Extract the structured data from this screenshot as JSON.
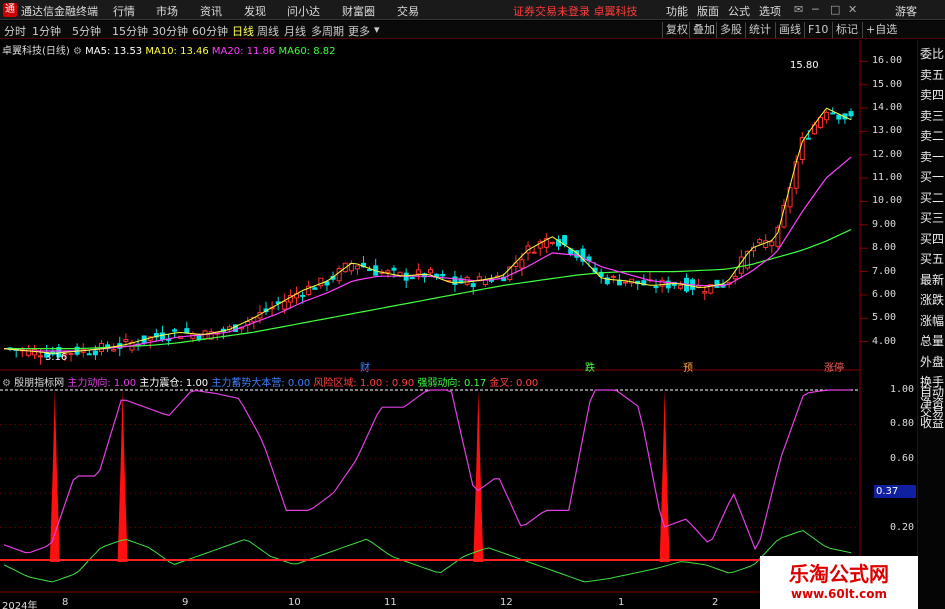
{
  "app": {
    "title": "通达信金融终端",
    "logo": "通"
  },
  "menu": [
    "行情",
    "市场",
    "资讯",
    "发现",
    "问小达",
    "财富圈",
    "交易"
  ],
  "notice": "证券交易未登录   卓翼科技",
  "right_menu": [
    "功能",
    "版面",
    "公式",
    "选项"
  ],
  "window_controls": {
    "user": "游客"
  },
  "periods": [
    "分时",
    "1分钟",
    "5分钟",
    "15分钟",
    "30分钟",
    "60分钟",
    "日线",
    "周线",
    "月线",
    "多周期",
    "更多"
  ],
  "active_period": "日线",
  "toolbar": {
    "restore": "复权",
    "overlay": "叠加",
    "multi": "多股",
    "stats": "统计",
    "draw": "画线",
    "f10": "F10",
    "mark": "标记",
    "watchlist": "+自选"
  },
  "sidebar": [
    "委比",
    "卖五",
    "卖四",
    "卖三",
    "卖二",
    "卖一",
    "买一",
    "买二",
    "买三",
    "买四",
    "买五",
    "最新",
    "涨跌",
    "涨幅",
    "总量",
    "外盘",
    "换手",
    "净资",
    "收益",
    "自动",
    "交易"
  ],
  "main_chart": {
    "stock": "卓翼科技(日线)",
    "ma5": "MA5: 13.53",
    "ma10": "MA10: 13.46",
    "ma20": "MA20: 11.86",
    "ma60": "MA60: 8.82",
    "high_label": "15.80",
    "low_label": "3.16",
    "y_ticks": [
      "16.00",
      "15.00",
      "14.00",
      "13.00",
      "12.00",
      "11.00",
      "10.00",
      "9.00",
      "8.00",
      "7.00",
      "6.00",
      "5.00",
      "4.00"
    ],
    "events": [
      "财",
      "跌",
      "预",
      "涨停"
    ],
    "colors": {
      "up": "#ff3030",
      "down": "#00e0e0",
      "ma5": "#ffffff",
      "ma10": "#ffff40",
      "ma20": "#ff40ff",
      "ma60": "#40ff40"
    }
  },
  "indicator": {
    "name": "殷朋指标网",
    "main_move": "主力动向: 1.00",
    "main_shake": "主力震仓: 1.00",
    "main_accum": "主力蓄势大本营: 0.00",
    "risk_zone": "风险区域: 1.00 : 0.90",
    "strong_weak": "强弱动向: 0.17",
    "golden_cross": "金叉: 0.00",
    "y_ticks": [
      "1.00",
      "0.80",
      "0.60",
      "0.40",
      "0.20"
    ],
    "readout": "0.37"
  },
  "x_axis": [
    "2024年",
    "8",
    "9",
    "10",
    "11",
    "12",
    "1",
    "2"
  ],
  "watermark": {
    "title": "乐淘公式网",
    "url": "www.60lt.com"
  },
  "chart_data": {
    "type": "candlestick",
    "title": "卓翼科技(日线)",
    "ylim": [
      3.0,
      16.4
    ],
    "x_labels": [
      "2024年",
      "8",
      "9",
      "10",
      "11",
      "12",
      "1",
      "2"
    ],
    "series": [
      {
        "name": "MA5",
        "value": 13.53
      },
      {
        "name": "MA10",
        "value": 13.46
      },
      {
        "name": "MA20",
        "value": 11.86
      },
      {
        "name": "MA60",
        "value": 8.82
      }
    ],
    "annotations": [
      {
        "text": "15.80",
        "y": 15.8
      },
      {
        "text": "3.16",
        "y": 3.16
      }
    ],
    "ma60_path": [
      3.7,
      3.7,
      3.7,
      3.7,
      3.75,
      3.8,
      3.85,
      3.95,
      4.1,
      4.25,
      4.4,
      4.6,
      4.8,
      5.0,
      5.2,
      5.4,
      5.6,
      5.8,
      6.0,
      6.2,
      6.4,
      6.55,
      6.7,
      6.85,
      6.95,
      7.0,
      7.0,
      7.0,
      7.05,
      7.1,
      7.3,
      7.6,
      7.9,
      8.3,
      8.8
    ],
    "close_path": [
      3.7,
      3.6,
      3.5,
      3.6,
      3.7,
      3.9,
      4.2,
      4.4,
      4.3,
      4.5,
      5.0,
      5.6,
      6.2,
      6.6,
      7.4,
      7.0,
      6.8,
      6.9,
      6.5,
      6.6,
      6.8,
      7.9,
      8.5,
      7.8,
      6.7,
      6.6,
      6.4,
      6.5,
      6.3,
      6.5,
      8.0,
      8.4,
      12.5,
      14.0,
      13.5
    ],
    "ma20_path": [
      3.7,
      3.6,
      3.6,
      3.6,
      3.7,
      3.8,
      4.0,
      4.2,
      4.3,
      4.4,
      4.8,
      5.2,
      5.7,
      6.1,
      6.6,
      6.8,
      6.8,
      6.8,
      6.7,
      6.6,
      6.7,
      7.2,
      7.8,
      7.7,
      7.2,
      6.9,
      6.6,
      6.5,
      6.4,
      6.4,
      7.0,
      7.8,
      9.5,
      11.0,
      11.9
    ],
    "indicator_path": [
      0.1,
      0.05,
      0.1,
      0.5,
      0.5,
      0.95,
      0.9,
      0.85,
      1.0,
      0.98,
      0.95,
      0.7,
      0.3,
      0.3,
      0.4,
      0.6,
      0.9,
      0.9,
      1.0,
      1.0,
      0.4,
      0.5,
      0.2,
      0.3,
      0.3,
      1.0,
      1.0,
      0.9,
      0.2,
      0.25,
      0.1,
      0.4,
      0.05,
      0.6,
      0.98,
      1.0,
      1.0
    ],
    "strong_path": [
      0.1,
      0.03,
      0.0,
      0.05,
      0.2,
      0.25,
      0.2,
      0.1,
      0.15,
      0.2,
      0.25,
      0.15,
      0.1,
      0.15,
      0.2,
      0.25,
      0.15,
      0.1,
      0.05,
      0.15,
      0.2,
      0.15,
      0.1,
      0.05,
      0.0,
      0.02,
      0.05,
      0.08,
      0.12,
      0.1,
      0.05,
      0.1,
      0.25,
      0.3,
      0.2,
      0.17
    ],
    "red_spikes": [
      0.06,
      0.14,
      0.56,
      0.78
    ]
  }
}
